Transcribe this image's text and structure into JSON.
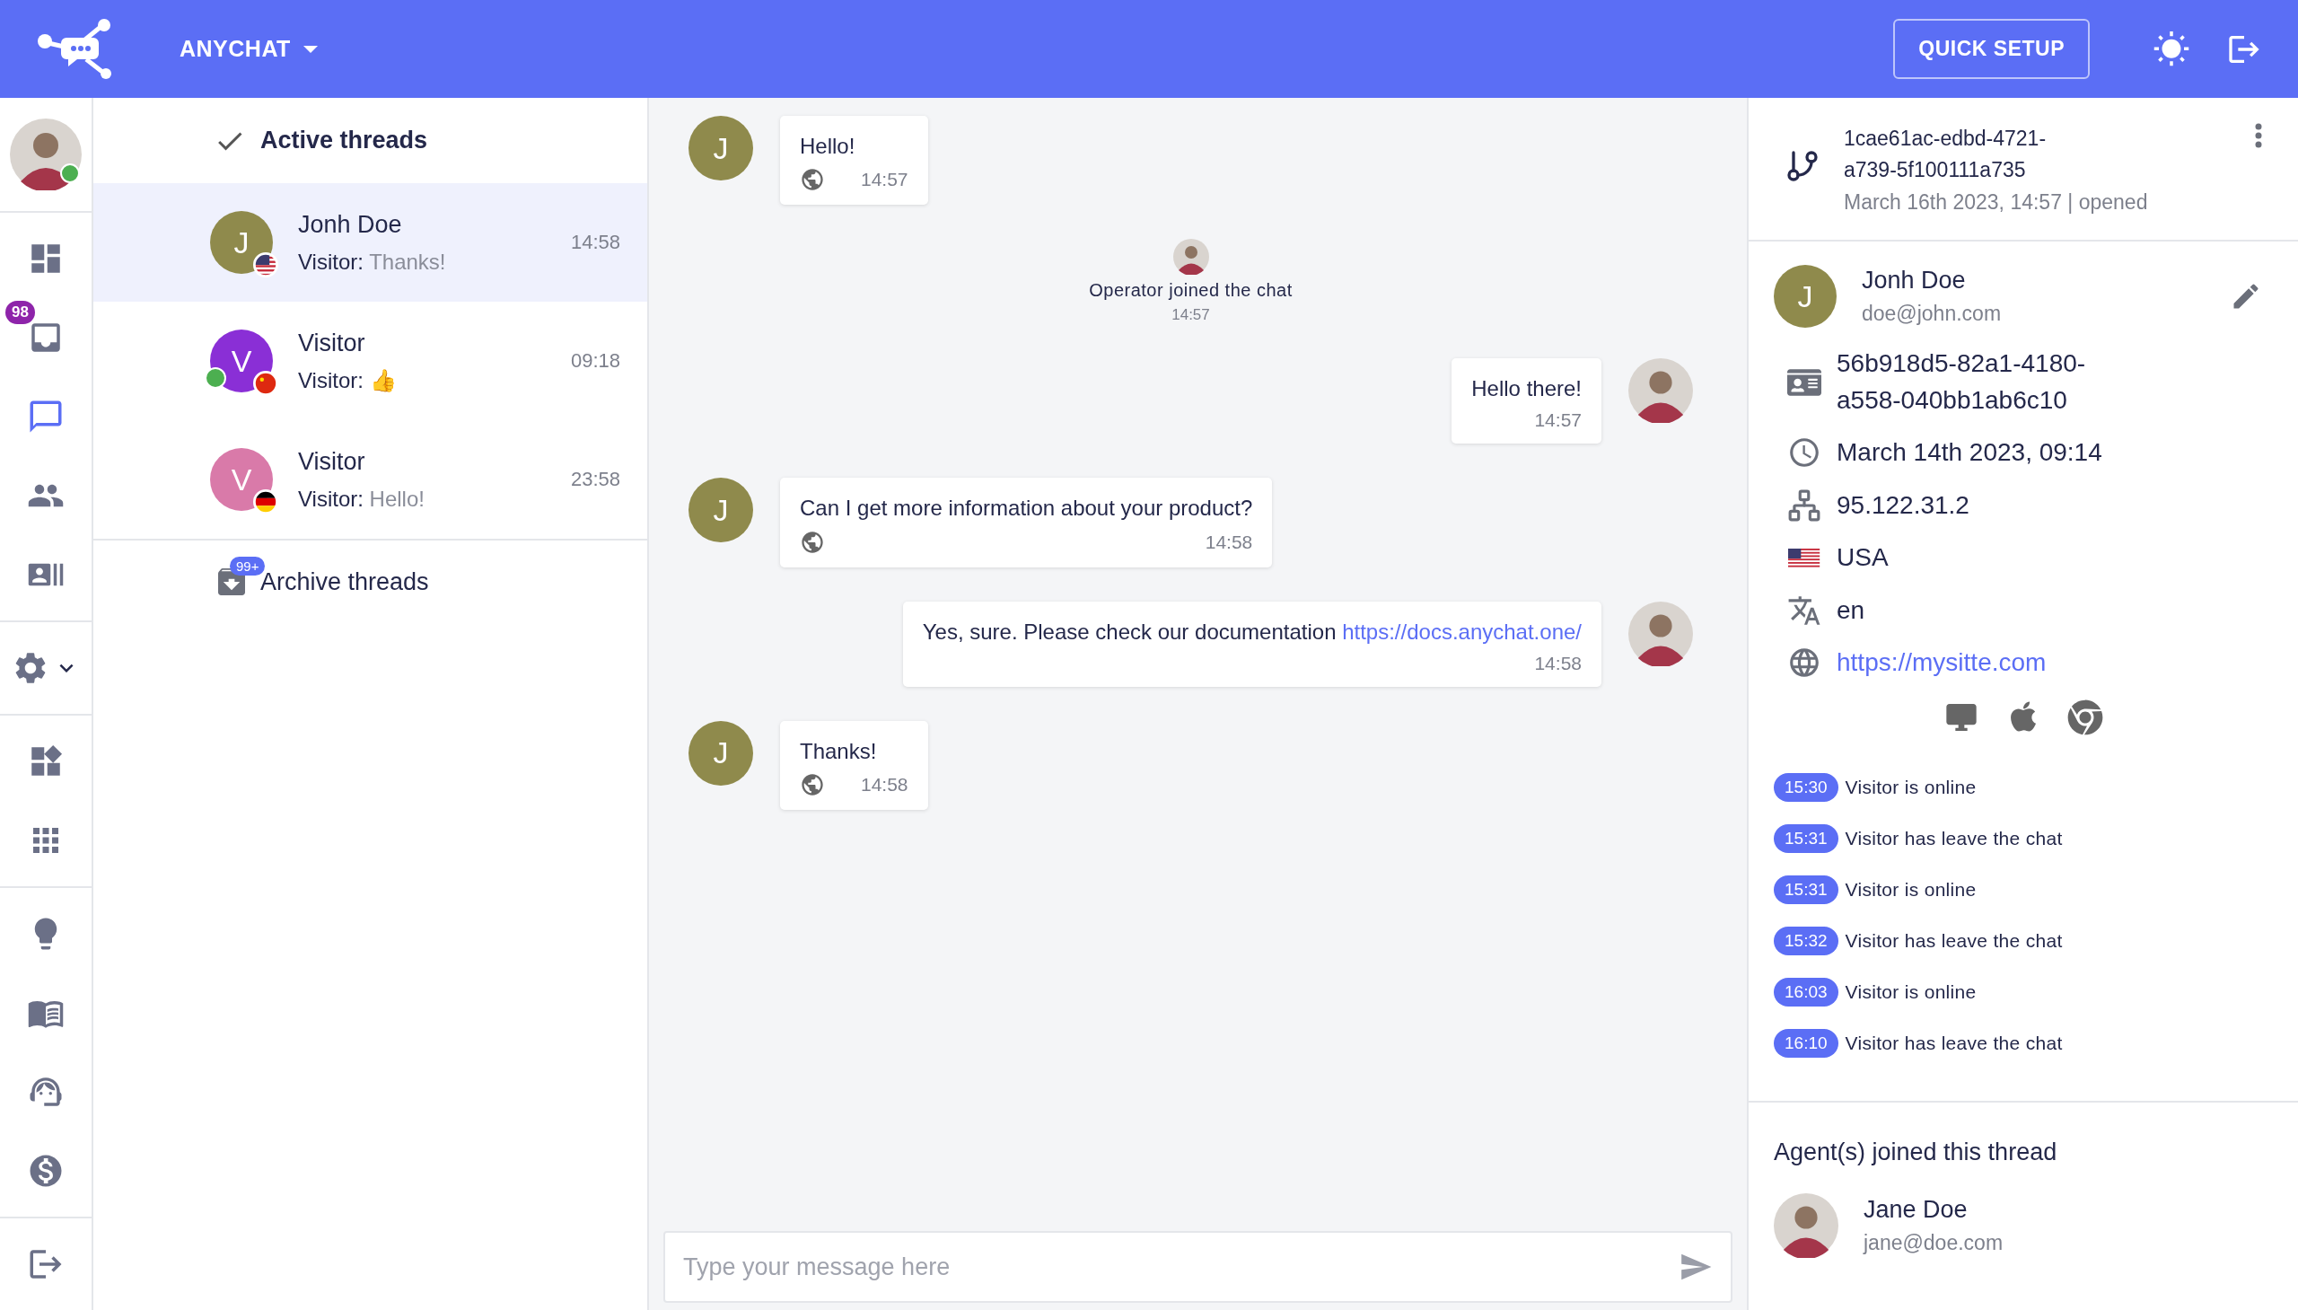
{
  "header": {
    "brand": "ANYCHAT",
    "quick_setup": "QUICK SETUP"
  },
  "profile": {
    "online": true
  },
  "nav": [
    {
      "items": [
        {
          "selected": false
        },
        {
          "selected": false,
          "badge": "98"
        },
        {
          "selected": true
        },
        {
          "selected": false
        },
        {
          "selected": false
        }
      ]
    },
    {
      "items": [
        {
          "selected": false
        }
      ]
    },
    {
      "items": [
        {
          "selected": false
        },
        {
          "selected": false
        }
      ]
    },
    {
      "items": [
        {
          "selected": false
        },
        {
          "selected": false
        },
        {
          "selected": false
        },
        {
          "selected": false
        }
      ]
    },
    {
      "items": [
        {
          "selected": false
        }
      ]
    }
  ],
  "threads": {
    "title": "Active threads",
    "items": [
      {
        "name": "Jonh Doe",
        "initial": "J",
        "color": "#8f8a4c",
        "online": false,
        "sender": "Visitor:",
        "preview": "Thanks!",
        "time": "14:58",
        "selected": true
      },
      {
        "name": "Visitor",
        "initial": "V",
        "color": "#8a2fd6",
        "online": true,
        "sender": "Visitor:",
        "preview": "👍",
        "time": "09:18",
        "selected": false
      },
      {
        "name": "Visitor",
        "initial": "V",
        "color": "#d97aa9",
        "online": false,
        "sender": "Visitor:",
        "preview": "Hello!",
        "time": "23:58",
        "selected": false
      }
    ],
    "archive": {
      "label": "Archive threads",
      "badge": "99+"
    }
  },
  "chat": {
    "messages": [
      {
        "kind": "visitor",
        "initial": "J",
        "text": "Hello!",
        "time": "14:57"
      },
      {
        "kind": "system",
        "text": "Operator joined the chat",
        "time": "14:57"
      },
      {
        "kind": "operator",
        "text": "Hello there!",
        "time": "14:57"
      },
      {
        "kind": "visitor",
        "initial": "J",
        "text": "Can I get more information about your product?",
        "time": "14:58"
      },
      {
        "kind": "operator",
        "text": "Yes, sure. Please check our documentation",
        "link": "https://docs.anychat.one/",
        "time": "14:58"
      },
      {
        "kind": "visitor",
        "initial": "J",
        "text": "Thanks!",
        "time": "14:58"
      }
    ],
    "composer": {
      "placeholder": "Type your message here"
    }
  },
  "details": {
    "thread_id": "1cae61ac-edbd-4721-a739-5f100111a735",
    "thread_meta": "March 16th 2023, 14:57 | opened",
    "visitor": {
      "initial": "J",
      "name": "Jonh Doe",
      "email": "doe@john.com"
    },
    "info": [
      {
        "kind": "id",
        "text": "56b918d5-82a1-4180-a558-040bb1ab6c10"
      },
      {
        "kind": "time",
        "text": "March 14th 2023, 09:14"
      },
      {
        "kind": "ip",
        "text": "95.122.31.2"
      },
      {
        "kind": "country",
        "text": "USA"
      },
      {
        "kind": "language",
        "text": "en"
      },
      {
        "kind": "website",
        "text": "https://mysitte.com"
      }
    ],
    "events": [
      {
        "time": "15:30",
        "text": "Visitor is online"
      },
      {
        "time": "15:31",
        "text": "Visitor has leave the chat"
      },
      {
        "time": "15:31",
        "text": "Visitor is online"
      },
      {
        "time": "15:32",
        "text": "Visitor has leave the chat"
      },
      {
        "time": "16:03",
        "text": "Visitor is online"
      },
      {
        "time": "16:10",
        "text": "Visitor has leave the chat"
      }
    ],
    "agents_title": "Agent(s) joined this thread",
    "agents": [
      {
        "name": "Jane Doe",
        "email": "jane@doe.com"
      }
    ]
  }
}
